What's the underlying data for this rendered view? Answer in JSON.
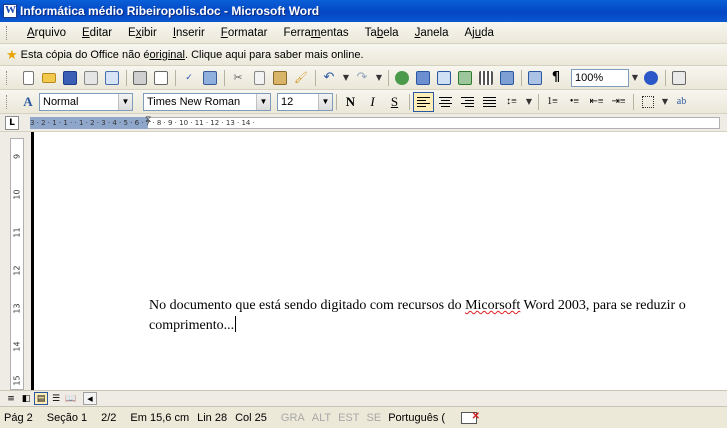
{
  "window": {
    "title": "Informática médio Ribeiropolis.doc - Microsoft Word"
  },
  "menu": {
    "items": [
      {
        "u": "A",
        "rest": "rquivo"
      },
      {
        "u": "E",
        "rest": "ditar"
      },
      {
        "pre": "E",
        "u": "x",
        "rest": "ibir"
      },
      {
        "u": "I",
        "rest": "nserir"
      },
      {
        "u": "F",
        "rest": "ormatar"
      },
      {
        "pre": "Ferra",
        "u": "m",
        "rest": "entas"
      },
      {
        "pre": "Ta",
        "u": "b",
        "rest": "ela"
      },
      {
        "u": "J",
        "rest": "anela"
      },
      {
        "pre": "Aj",
        "u": "u",
        "rest": "da"
      }
    ]
  },
  "notice": {
    "text_pre": "Esta cópia do Office não é ",
    "link": "original",
    "text_post": ".  Clique aqui para saber mais online."
  },
  "standard": {
    "zoom": "100%"
  },
  "formatting": {
    "style": "Normal",
    "font": "Times New Roman",
    "size": "12"
  },
  "ruler": {
    "h_labels": "3 · 2 · 1 · 1 ·   · 1 · 2 · 3 · 4 · 5 · 6 · 7 · 8 · 9 · 10 · 11 · 12 · 13 · 14 ·",
    "v_labels": [
      "9",
      "10",
      "11",
      "12",
      "13",
      "14",
      "15"
    ]
  },
  "document": {
    "text_1": "No documento que está sendo digitado com recursos do ",
    "misspelled": "Micorsoft",
    "text_2": " Word 2003, para se reduzir o comprimento..."
  },
  "status": {
    "page": "Pág 2",
    "section": "Seção 1",
    "pages": "2/2",
    "at": "Em 15,6 cm",
    "line": "Lin 28",
    "col": "Col 25",
    "gra": "GRA",
    "alt": "ALT",
    "est": "EST",
    "se": "SE",
    "language": "Português ("
  },
  "colors": {
    "title_blue": "#0346c4",
    "toolbar_bg": "#ece9d8",
    "squiggle": "#e02020"
  }
}
